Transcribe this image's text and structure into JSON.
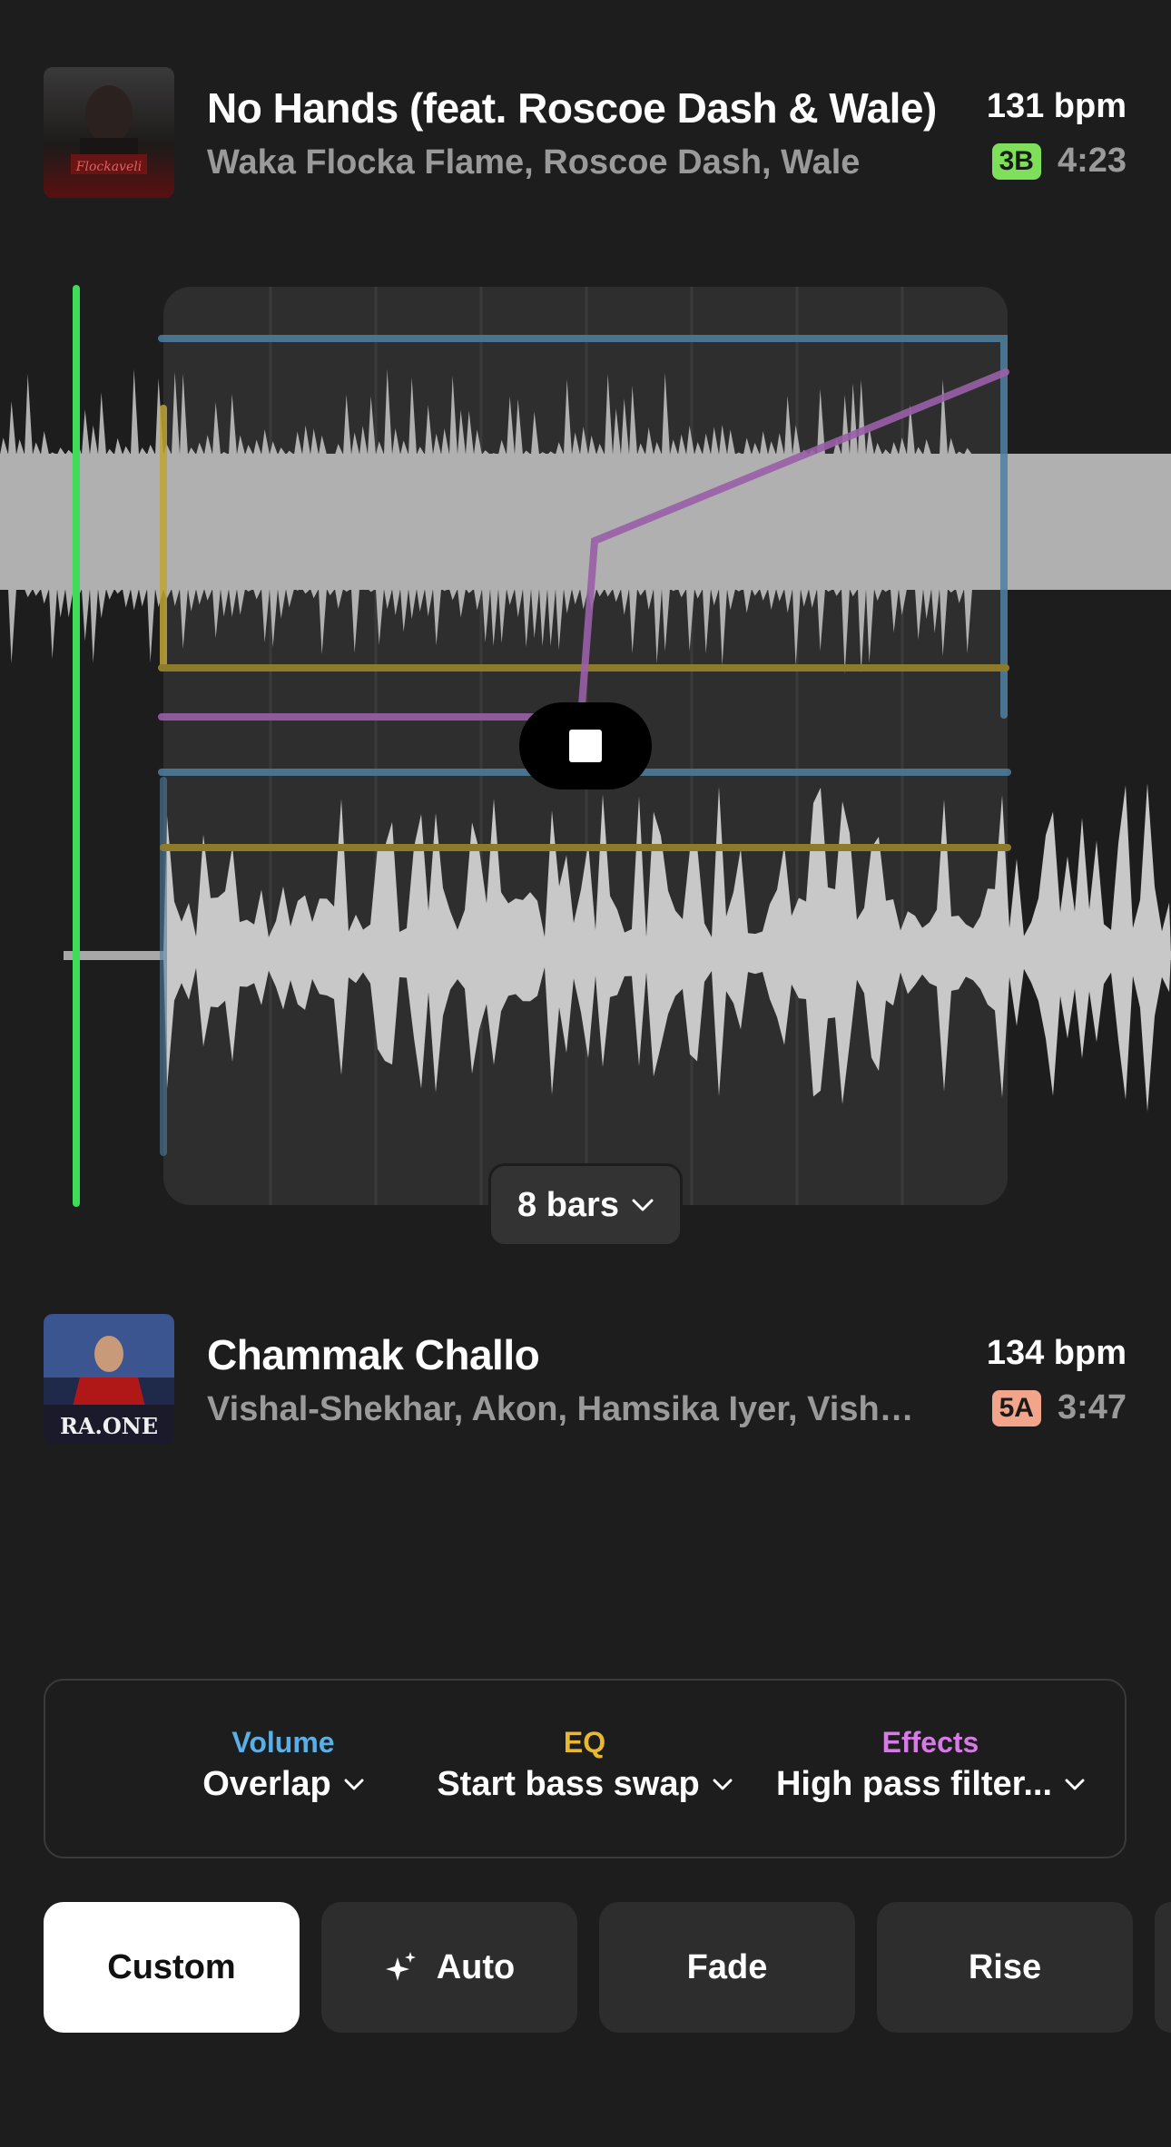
{
  "track_top": {
    "title": "No Hands (feat. Roscoe Dash & Wale)",
    "artist": "Waka Flocka Flame, Roscoe Dash, Wale",
    "bpm": "131 bpm",
    "key": "3B",
    "key_color": "#7ee05a",
    "duration": "4:23"
  },
  "transition": {
    "length_label": "8 bars"
  },
  "track_bottom": {
    "title": "Chammak Challo",
    "artist": "Vishal-Shekhar, Akon, Hamsika Iyer, Vishal...",
    "bpm": "134 bpm",
    "key": "5A",
    "key_color": "#f2a58a",
    "duration": "3:47"
  },
  "settings": {
    "volume": {
      "label": "Volume",
      "value": "Overlap",
      "color": "#5ab0e6"
    },
    "eq": {
      "label": "EQ",
      "value": "Start bass swap",
      "color": "#e8b830"
    },
    "effects": {
      "label": "Effects",
      "value": "High pass filter...",
      "color": "#d67ae6"
    }
  },
  "presets": [
    {
      "label": "Custom",
      "active": true
    },
    {
      "label": "Auto",
      "icon": "sparkle-icon"
    },
    {
      "label": "Fade"
    },
    {
      "label": "Rise"
    }
  ],
  "colors": {
    "playhead": "#3fdc5a",
    "background": "#1d1d1d"
  }
}
